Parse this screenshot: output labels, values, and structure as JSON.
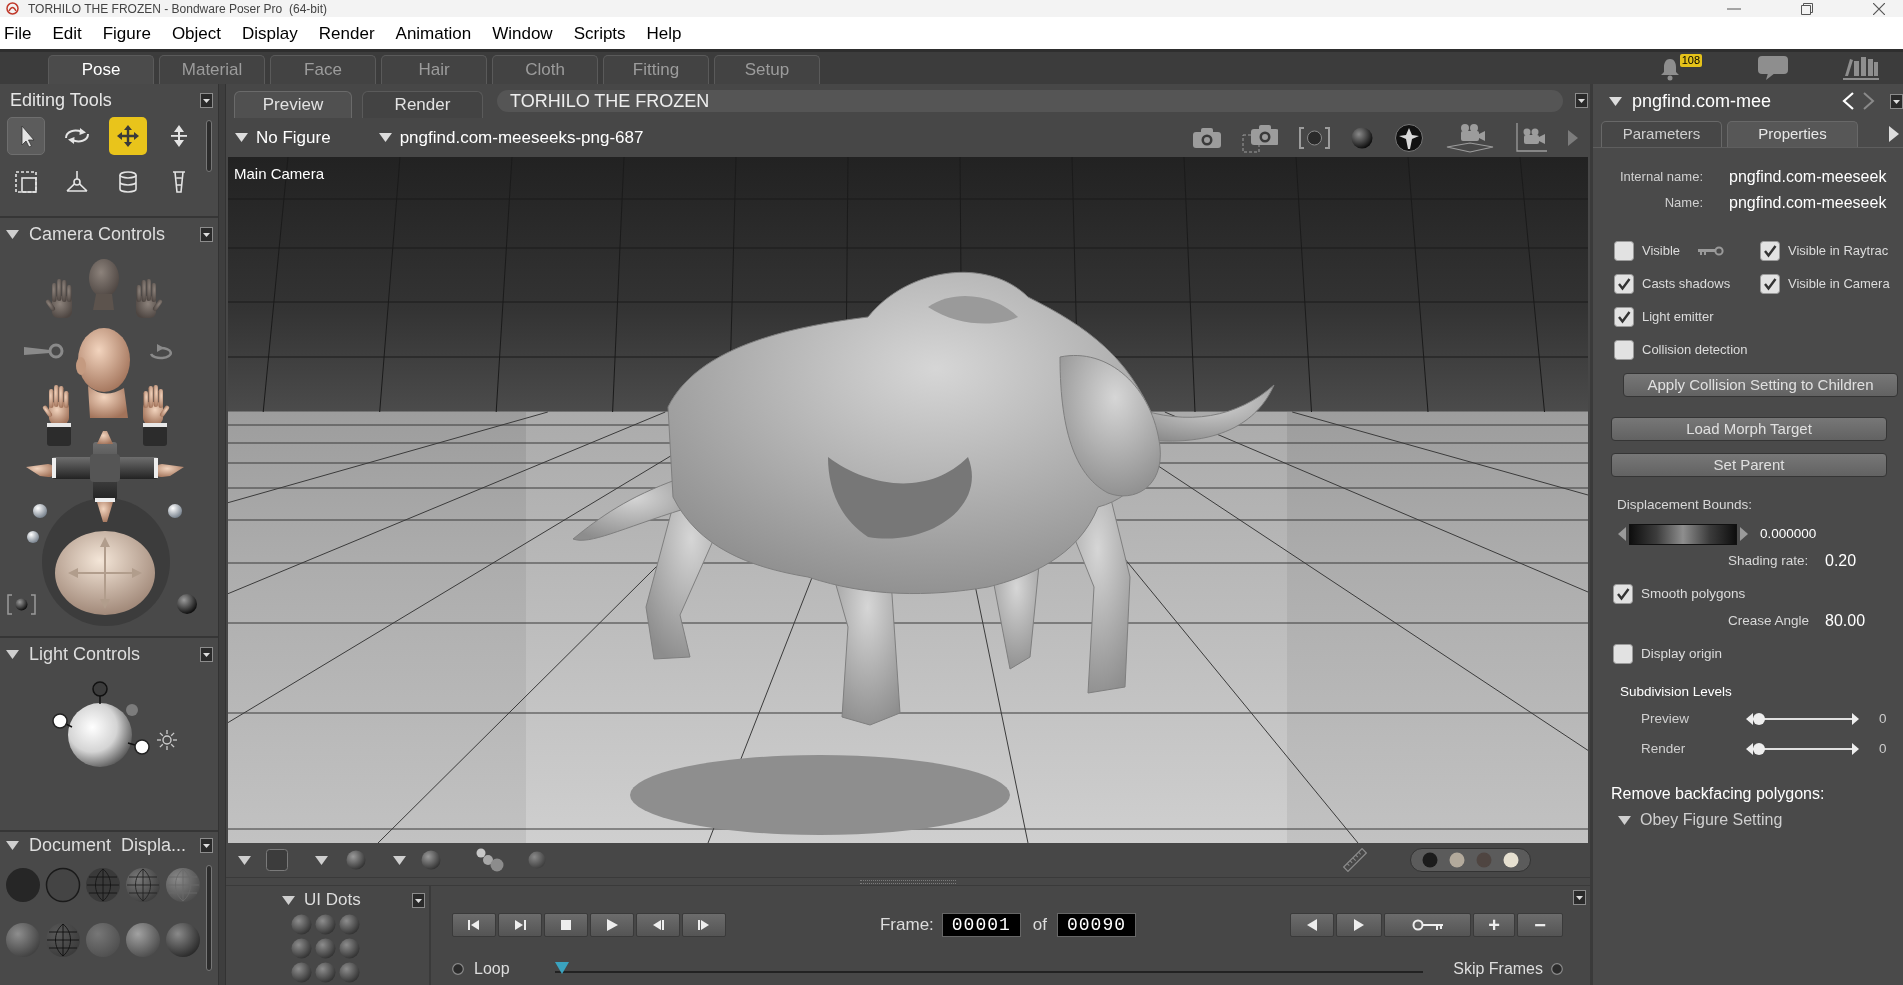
{
  "window": {
    "title": "TORHILO THE FROZEN - Bondware Poser Pro  (64-bit)"
  },
  "menu_bar": [
    "File",
    "Edit",
    "Figure",
    "Object",
    "Display",
    "Render",
    "Animation",
    "Window",
    "Scripts",
    "Help"
  ],
  "room_tabs": [
    {
      "label": "Pose",
      "selected": true
    },
    {
      "label": "Material",
      "selected": false
    },
    {
      "label": "Face",
      "selected": false
    },
    {
      "label": "Hair",
      "selected": false
    },
    {
      "label": "Cloth",
      "selected": false
    },
    {
      "label": "Fitting",
      "selected": false
    },
    {
      "label": "Setup",
      "selected": false
    }
  ],
  "notifications": {
    "count": "108"
  },
  "editing_tools": {
    "title": "Editing Tools",
    "tools": [
      {
        "kind": "select",
        "selected": false,
        "hovered": true
      },
      {
        "kind": "rotate",
        "selected": false,
        "hovered": false
      },
      {
        "kind": "translate",
        "selected": true,
        "hovered": false
      },
      {
        "kind": "move_vertical",
        "selected": false,
        "hovered": false
      },
      {
        "kind": "box_select",
        "selected": false,
        "hovered": false
      },
      {
        "kind": "axes",
        "selected": false,
        "hovered": false
      },
      {
        "kind": "stack",
        "selected": false,
        "hovered": false
      },
      {
        "kind": "taper",
        "selected": false,
        "hovered": false
      }
    ]
  },
  "camera_controls": {
    "title": "Camera Controls"
  },
  "light_controls": {
    "title": "Light Controls"
  },
  "document_display": {
    "title": "Document  Displa...",
    "styles": [
      {
        "kind": "silhouette"
      },
      {
        "kind": "outline"
      },
      {
        "kind": "wireframe"
      },
      {
        "kind": "hidden_line"
      },
      {
        "kind": "lit_wireframe"
      },
      {
        "kind": "flat_shaded"
      },
      {
        "kind": "flat_lined"
      },
      {
        "kind": "cartoon"
      },
      {
        "kind": "smooth_shaded"
      },
      {
        "kind": "texture_shaded"
      }
    ]
  },
  "viewport": {
    "tabs": [
      {
        "label": "Preview",
        "selected": true
      },
      {
        "label": "Render",
        "selected": false
      }
    ],
    "document_title": "TORHILO THE FROZEN",
    "figure_menu": "No Figure",
    "actor_menu": "pngfind.com-meeseeks-png-687",
    "camera_label": "Main Camera",
    "background_colors": [
      {
        "color": "#1c1c1c"
      },
      {
        "color": "#b3aa9c"
      },
      {
        "color": "#4f4541"
      },
      {
        "color": "#e6e0d0"
      }
    ]
  },
  "ui_dots": {
    "title": "UI Dots"
  },
  "animation": {
    "frame_label": "Frame:",
    "current_frame": "00001",
    "of_label": "of",
    "total_frames": "00090",
    "add_key": "+",
    "remove_key": "−",
    "loop_label": "Loop",
    "loop": false,
    "timeline": {
      "level": 0
    },
    "skip_frames_label": "Skip Frames",
    "skip_frames": false
  },
  "properties_panel": {
    "title": "pngfind.com-mee",
    "tabs": [
      {
        "label": "Parameters",
        "selected": false
      },
      {
        "label": "Properties",
        "selected": true
      }
    ],
    "fields": [
      {
        "label": "Internal name:",
        "value": "pngfind.com-meeseek"
      },
      {
        "label": "Name:",
        "value": "pngfind.com-meeseek"
      }
    ],
    "checkbox_rows": [
      [
        {
          "kind": "keyed",
          "label": "Visible",
          "checked": false
        },
        {
          "kind": "plain",
          "label": "Visible in Raytrac",
          "checked": true
        }
      ],
      [
        {
          "kind": "plain",
          "label": "Casts shadows",
          "checked": true
        },
        {
          "kind": "plain",
          "label": "Visible in Camera",
          "checked": true
        }
      ],
      [
        {
          "kind": "plain",
          "label": "Light emitter",
          "checked": true
        }
      ],
      [
        {
          "kind": "plain",
          "label": "Collision detection",
          "checked": false
        }
      ]
    ],
    "apply_button": "Apply Collision Setting to Children",
    "buttons": [
      "Load Morph Target",
      "Set Parent"
    ],
    "displacement": {
      "label": "Displacement Bounds:",
      "value": "0.000000"
    },
    "shading_rate": {
      "label": "Shading rate:",
      "value": "0.20"
    },
    "smooth_polygons": {
      "label": "Smooth polygons",
      "checked": true
    },
    "crease_angle": {
      "label": "Crease Angle",
      "value": "80.00"
    },
    "display_origin": {
      "label": "Display origin",
      "checked": false
    },
    "subdivision": {
      "title": "Subdivision Levels",
      "levels": [
        {
          "label": "Preview",
          "level": 0,
          "value": "0"
        },
        {
          "label": "Render",
          "level": 0,
          "value": "0"
        }
      ]
    },
    "backfacing": {
      "label": "Remove backfacing polygons:",
      "menu": "Obey Figure Setting"
    }
  }
}
